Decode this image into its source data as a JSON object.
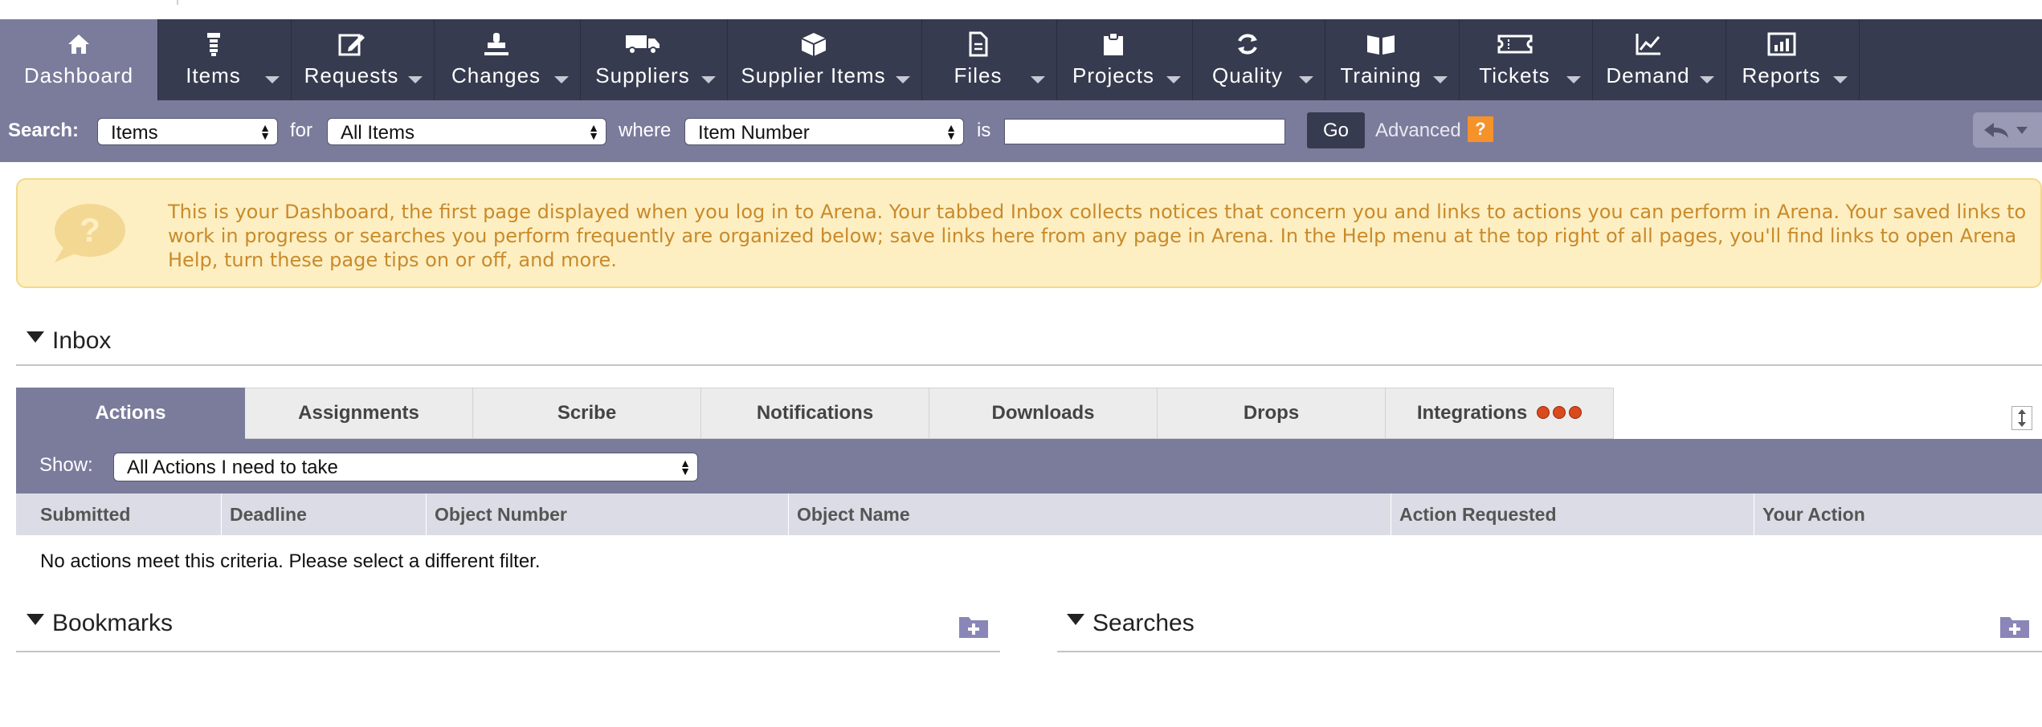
{
  "nav": {
    "items": [
      {
        "label": "Dashboard",
        "icon": "home-icon",
        "active": true
      },
      {
        "label": "Items",
        "icon": "items-icon"
      },
      {
        "label": "Requests",
        "icon": "edit-icon"
      },
      {
        "label": "Changes",
        "icon": "stamp-icon"
      },
      {
        "label": "Suppliers",
        "icon": "truck-icon"
      },
      {
        "label": "Supplier Items",
        "icon": "box-icon"
      },
      {
        "label": "Files",
        "icon": "file-icon"
      },
      {
        "label": "Projects",
        "icon": "clipboard-icon"
      },
      {
        "label": "Quality",
        "icon": "refresh-icon"
      },
      {
        "label": "Training",
        "icon": "book-icon"
      },
      {
        "label": "Tickets",
        "icon": "ticket-icon"
      },
      {
        "label": "Demand",
        "icon": "line-chart-icon"
      },
      {
        "label": "Reports",
        "icon": "bar-chart-icon"
      }
    ]
  },
  "search": {
    "label": "Search:",
    "type_value": "Items",
    "for_label": "for",
    "scope_value": "All Items",
    "where_label": "where",
    "field_value": "Item Number",
    "is_label": "is",
    "query_value": "",
    "go_label": "Go",
    "advanced_label": "Advanced",
    "help_label": "?"
  },
  "tip": {
    "text": "This is your Dashboard, the first page displayed when you log in to Arena. Your tabbed Inbox collects notices that concern you and links to actions you can perform in Arena. Your saved links to work in progress or searches you perform frequently are organized below; save links here from any page in Arena. In the Help menu at the top right of all pages, you'll find links to open Arena Help, turn these page tips on or off, and more."
  },
  "inbox": {
    "title": "Inbox",
    "tabs": [
      {
        "label": "Actions",
        "active": true
      },
      {
        "label": "Assignments"
      },
      {
        "label": "Scribe"
      },
      {
        "label": "Notifications"
      },
      {
        "label": "Downloads"
      },
      {
        "label": "Drops"
      },
      {
        "label": "Integrations",
        "status_dots": 3
      }
    ],
    "show_label": "Show:",
    "show_value": "All Actions I need to take",
    "columns": [
      "Submitted",
      "Deadline",
      "Object Number",
      "Object Name",
      "Action Requested",
      "Your Action"
    ],
    "empty_message": "No actions meet this criteria. Please select a different filter."
  },
  "bookmarks": {
    "title": "Bookmarks"
  },
  "searches": {
    "title": "Searches"
  },
  "colors": {
    "nav_bg": "#373b4f",
    "accent": "#7b7b9c",
    "tip_bg": "#fdefc2",
    "tip_text": "#c98a2b",
    "help_orange": "#f5922a",
    "status_dot": "#d94a1d"
  }
}
